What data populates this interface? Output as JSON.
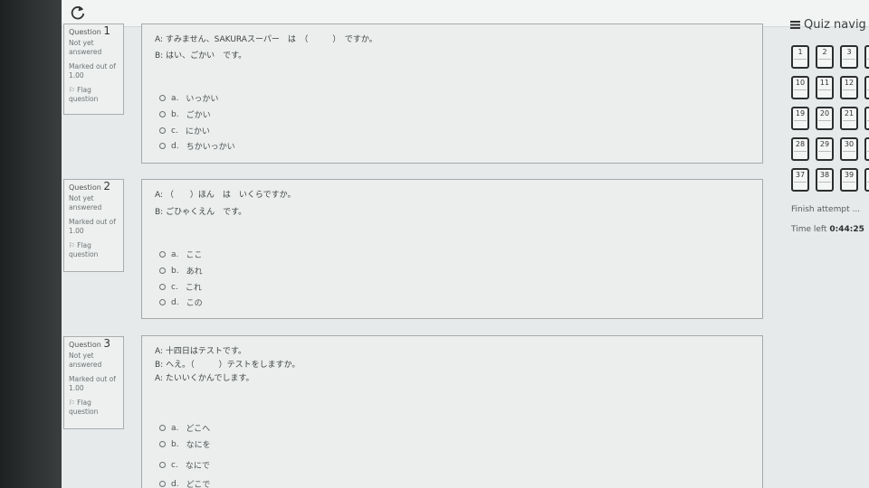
{
  "questions": [
    {
      "label": "Question",
      "number": "1",
      "state": [
        "Not yet",
        "answered"
      ],
      "marks": [
        "Marked out of",
        "1.00"
      ],
      "flag": [
        "Flag",
        "question"
      ],
      "text": [
        "A: すみません、SAKURAスーパー　は　（　　　）　ですか。",
        "B: はい、ごかい　です。"
      ],
      "options": [
        {
          "letter": "a.",
          "text": "いっかい"
        },
        {
          "letter": "b.",
          "text": "ごかい"
        },
        {
          "letter": "c.",
          "text": "にかい"
        },
        {
          "letter": "d.",
          "text": "ちかいっかい"
        }
      ]
    },
    {
      "label": "Question",
      "number": "2",
      "state": [
        "Not yet",
        "answered"
      ],
      "marks": [
        "Marked out of",
        "1.00"
      ],
      "flag": [
        "Flag",
        "question"
      ],
      "text": [
        "A: （　　）ほん　は　いくらですか。",
        "B: ごひゃくえん　です。"
      ],
      "options": [
        {
          "letter": "a.",
          "text": "ここ"
        },
        {
          "letter": "b.",
          "text": "あれ"
        },
        {
          "letter": "c.",
          "text": "これ"
        },
        {
          "letter": "d.",
          "text": "この"
        }
      ]
    },
    {
      "label": "Question",
      "number": "3",
      "state": [
        "Not yet",
        "answered"
      ],
      "marks": [
        "Marked out of",
        "1.00"
      ],
      "flag": [
        "Flag",
        "question"
      ],
      "text": [
        "A: 十四日はテストです。",
        "B: へえ。（　　　）テストをしますか。",
        "A: たいいくかんでします。"
      ],
      "options": [
        {
          "letter": "a.",
          "text": "どこへ"
        },
        {
          "letter": "b.",
          "text": "なにを"
        },
        {
          "letter": "c.",
          "text": "なにで"
        },
        {
          "letter": "d.",
          "text": "どこで"
        }
      ]
    }
  ],
  "nav": {
    "title": "Quiz navig",
    "rows": [
      [
        "1",
        "2",
        "3"
      ],
      [
        "10",
        "11",
        "12"
      ],
      [
        "19",
        "20",
        "21"
      ],
      [
        "28",
        "29",
        "30"
      ],
      [
        "37",
        "38",
        "39"
      ]
    ],
    "finish": "Finish attempt ...",
    "time_label": "Time left",
    "time_value": "0:44:25"
  },
  "icons": {
    "reload": "reload-icon",
    "flag": "flag-icon",
    "menu": "hamburger-icon"
  }
}
